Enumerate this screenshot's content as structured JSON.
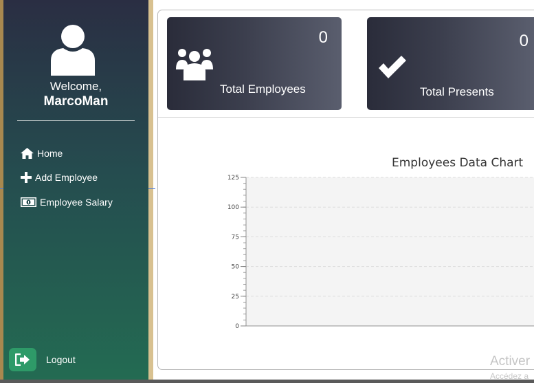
{
  "sidebar": {
    "welcome": "Welcome,",
    "username": "MarcoMan",
    "nav": [
      {
        "label": "Home",
        "icon": "home-icon"
      },
      {
        "label": "Add Employee",
        "icon": "plus-icon"
      },
      {
        "label": "Employee Salary",
        "icon": "money-icon"
      }
    ],
    "logout": {
      "label": "Logout",
      "icon": "sign-out-icon"
    }
  },
  "cards": [
    {
      "label": "Total Employees",
      "value": "0",
      "icon": "users-icon"
    },
    {
      "label": "Total Presents",
      "value": "0",
      "icon": "check-icon"
    }
  ],
  "colors": {
    "sidebar_top": "#2a2e43",
    "sidebar_bottom": "#236b52",
    "logout_button": "#2e9a68",
    "card_dark": "#2a2c3a"
  },
  "chart_data": {
    "type": "bar",
    "title": "Employees Data Chart",
    "categories": [],
    "series": [],
    "ylim": [
      0,
      125
    ],
    "yticks": [
      0,
      25,
      50,
      75,
      100,
      125
    ],
    "grid": true
  },
  "watermark": {
    "title": "Activer",
    "subtitle": "Accédez a"
  }
}
